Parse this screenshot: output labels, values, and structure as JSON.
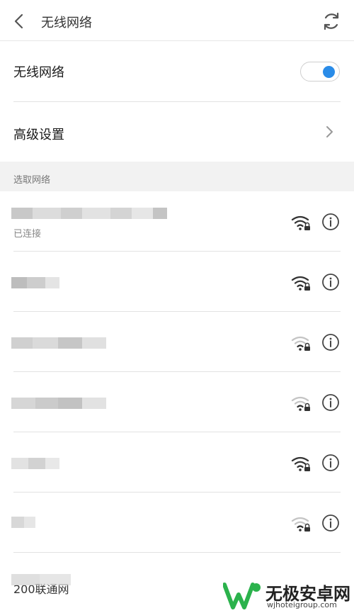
{
  "header": {
    "title": "无线网络",
    "back_icon": "chevron-left-icon",
    "refresh_icon": "refresh-icon"
  },
  "settings": {
    "wifi_label": "无线网络",
    "wifi_enabled": true,
    "advanced_label": "高级设置"
  },
  "section": {
    "caption": "选取网络"
  },
  "networks": [
    {
      "name": "",
      "status": "已连接",
      "signal": "strong"
    },
    {
      "name": "",
      "status": "",
      "signal": "strong"
    },
    {
      "name": "",
      "status": "",
      "signal": "weak"
    },
    {
      "name": "",
      "status": "",
      "signal": "weak"
    },
    {
      "name": "",
      "status": "",
      "signal": "strong"
    },
    {
      "name": "",
      "status": "",
      "signal": "weak"
    },
    {
      "name": "200联通网",
      "status": "",
      "signal": "strong"
    }
  ],
  "watermark": {
    "name": "无极安卓网",
    "url": "wjhoteigroup.com"
  },
  "colors": {
    "accent": "#2a8ce8",
    "watermark_green": "#2bb24c"
  }
}
